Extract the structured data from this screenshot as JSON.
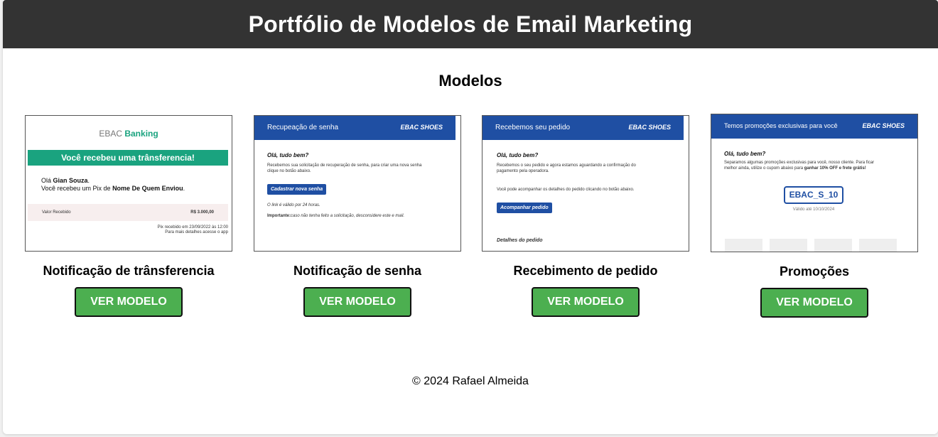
{
  "header": {
    "title": "Portfólio de Modelos de Email Marketing"
  },
  "section": {
    "title": "Modelos"
  },
  "cards": [
    {
      "title": "Notificação de trânsferencia",
      "button": "VER MODELO",
      "preview": {
        "logo_prefix": "EBAC",
        "logo_brand": "Banking",
        "banner": "Você recebeu uma trânsferencia!",
        "greeting_prefix": "Olá ",
        "greeting_name": "Gian Souza",
        "greeting_suffix": ".",
        "line_prefix": "Você recebeu um Pix de ",
        "line_sender": "Nome De Quem Enviou",
        "line_suffix": ".",
        "value_label": "Valor Recebido",
        "value_amount": "R$ 3.000,00",
        "note1": "Pix recebido em 23/09/2022 às 12:00",
        "note2": "Para mais detalhes acesse o app"
      }
    },
    {
      "title": "Notificação de senha",
      "button": "VER MODELO",
      "preview": {
        "header_left": "Recupeação de senha",
        "header_right": "EBAC SHOES",
        "greeting": "Olá, tudo bem?",
        "body1": "Recebemos sua solicitação de recuperação de senha, para criar uma nova senha",
        "body2": "clique no botão abaixo.",
        "cta": "Cadastrar nova senha",
        "validity": "O link é válido por 24 horas.",
        "important_label": "Importante:",
        "important_text": "caso não tenha feito a solicitação, desconsidere este e mail."
      }
    },
    {
      "title": "Recebimento de pedido",
      "button": "VER MODELO",
      "preview": {
        "header_left": "Recebemos seu pedido",
        "header_right": "EBAC SHOES",
        "greeting": "Olá, tudo bem?",
        "body1": "Recebemos o seu pedido e agora estamos aguardando a confirmação do",
        "body2": "pagamento pela operadora.",
        "body3": "Você pode acompanhar os detalhes do pedido clicando no botão abaixo.",
        "cta": "Acompanhar pedido",
        "details": "Detalhes do pedido"
      }
    },
    {
      "title": "Promoções",
      "button": "VER MODELO",
      "preview": {
        "header_left": "Temos promoções exclusivas para você",
        "header_right": "EBAC SHOES",
        "greeting": "Olá, tudo bem?",
        "body1": "Separamos algumas promoções exclusivas para você, nosso cliente. Para ficar",
        "body2_prefix": "melhor ainda, utilize o cupom abaixo para ",
        "body2_bold": "ganhar 10% OFF e frete grátis!",
        "coupon": "EBAC_S_10",
        "valid": "Válido até 10/10/2024"
      }
    }
  ],
  "footer": {
    "text": "© 2024 Rafael Almeida"
  },
  "colors": {
    "header_bg": "#333333",
    "button_bg": "#4caf50",
    "banking_green": "#1aa37f",
    "shoes_blue": "#1f4fa3"
  }
}
